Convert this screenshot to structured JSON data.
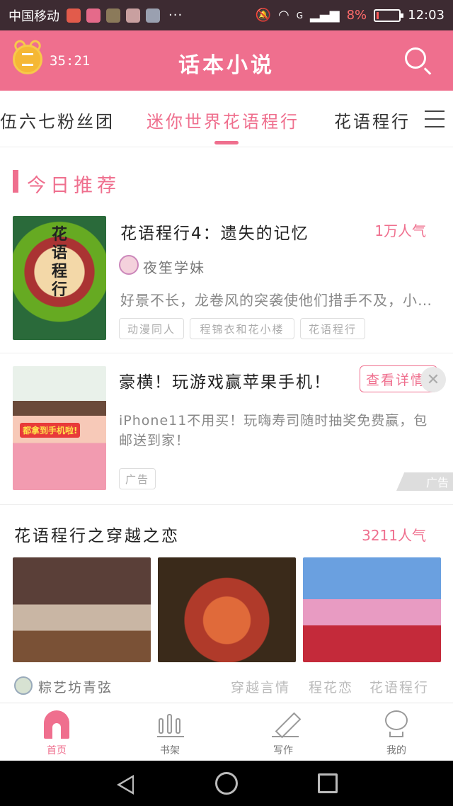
{
  "status_bar": {
    "carrier": "中国移动",
    "more": "···",
    "signal_label": "G",
    "battery_percent": "8%",
    "time": "12:03"
  },
  "header": {
    "timer": "35:21",
    "title": "话本小说",
    "search_icon": "search-icon"
  },
  "tabs": [
    {
      "label": "伍六七粉丝团",
      "active": false
    },
    {
      "label": "迷你世界花语程行",
      "active": true
    },
    {
      "label": "花语程行",
      "active": false
    }
  ],
  "section": {
    "title": "今日推荐"
  },
  "recommend": {
    "title": "花语程行4：遗失的记忆",
    "popularity": "1万人气",
    "author": "夜笙学妹",
    "description": "好景不长，龙卷风的突袭使他们措手不及，小樱和花小楼被迫分开",
    "tags": [
      "动漫同人",
      "程锦衣和花小楼",
      "花语程行"
    ],
    "cover_text": "花语程行"
  },
  "ad": {
    "title": "豪横！玩游戏赢苹果手机！",
    "button": "查看详情",
    "close": "✕",
    "description": "iPhone11不用买！玩嗨寿司随时抽奖免费赢，包邮送到家！",
    "tag": "广告",
    "mark": "广告",
    "image_caption": "都拿到手机啦!"
  },
  "topic": {
    "title": "花语程行之穿越之恋",
    "popularity": "3211人气",
    "author": "粽艺坊青弦",
    "tags": [
      "穿越言情",
      "程花恋",
      "花语程行"
    ]
  },
  "bottom_nav": [
    {
      "label": "首页",
      "active": true
    },
    {
      "label": "书架",
      "active": false
    },
    {
      "label": "写作",
      "active": false
    },
    {
      "label": "我的",
      "active": false
    }
  ],
  "colors": {
    "accent": "#ef6f8e",
    "status_bar": "#3d2b32"
  }
}
